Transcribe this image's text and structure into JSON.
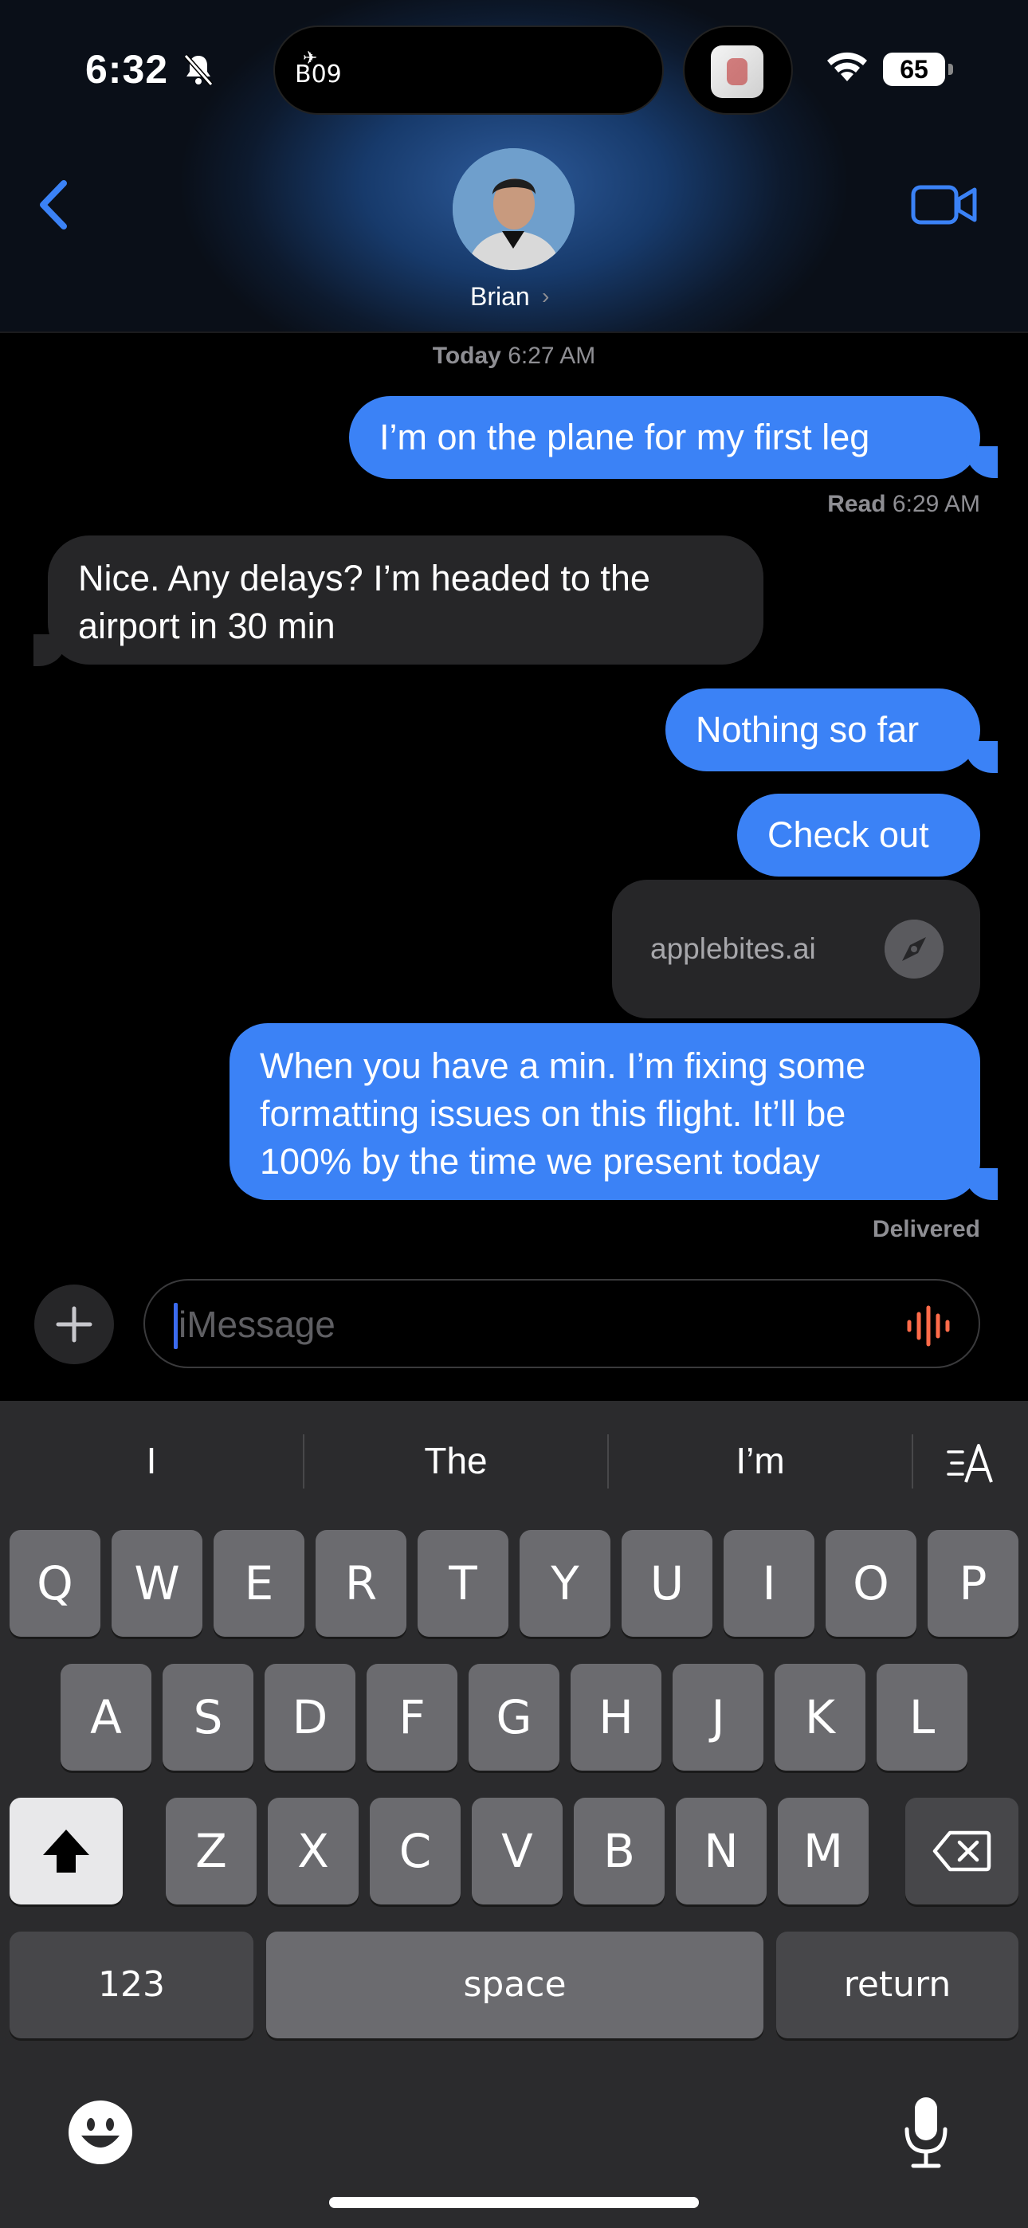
{
  "status_bar": {
    "time": "6:32",
    "island_label": "B09",
    "battery": "65"
  },
  "header": {
    "contact_name": "Brian",
    "chevron": "›"
  },
  "conversation": {
    "timestamp_day": "Today",
    "timestamp_time": "6:27 AM",
    "messages": [
      {
        "text": "I’m on the plane for my first leg"
      },
      {
        "text_line1": "Nice. Any delays? I’m headed to the",
        "text_line2": "airport in 30 min"
      },
      {
        "text": "Nothing so far"
      },
      {
        "text": "Check out"
      },
      {
        "text_line1": "When you have a min. I’m fixing some",
        "text_line2": "formatting issues on this flight. It’ll be",
        "text_line3": "100% by the time we present today"
      }
    ],
    "read_label": "Read",
    "read_time": "6:29 AM",
    "delivered": "Delivered",
    "link_card": {
      "domain": "applebites.ai"
    }
  },
  "input": {
    "placeholder": "iMessage"
  },
  "keyboard": {
    "suggestions": [
      "I",
      "The",
      "I’m"
    ],
    "row1": [
      "Q",
      "W",
      "E",
      "R",
      "T",
      "Y",
      "U",
      "I",
      "O",
      "P"
    ],
    "row2": [
      "A",
      "S",
      "D",
      "F",
      "G",
      "H",
      "J",
      "K",
      "L"
    ],
    "row3": [
      "Z",
      "X",
      "C",
      "V",
      "B",
      "N",
      "M"
    ],
    "numbers_key": "123",
    "space_key": "space",
    "return_key": "return"
  },
  "colors": {
    "accent": "#3b82f6",
    "incoming": "#262628",
    "keyboard_bg": "#2b2b2d"
  }
}
